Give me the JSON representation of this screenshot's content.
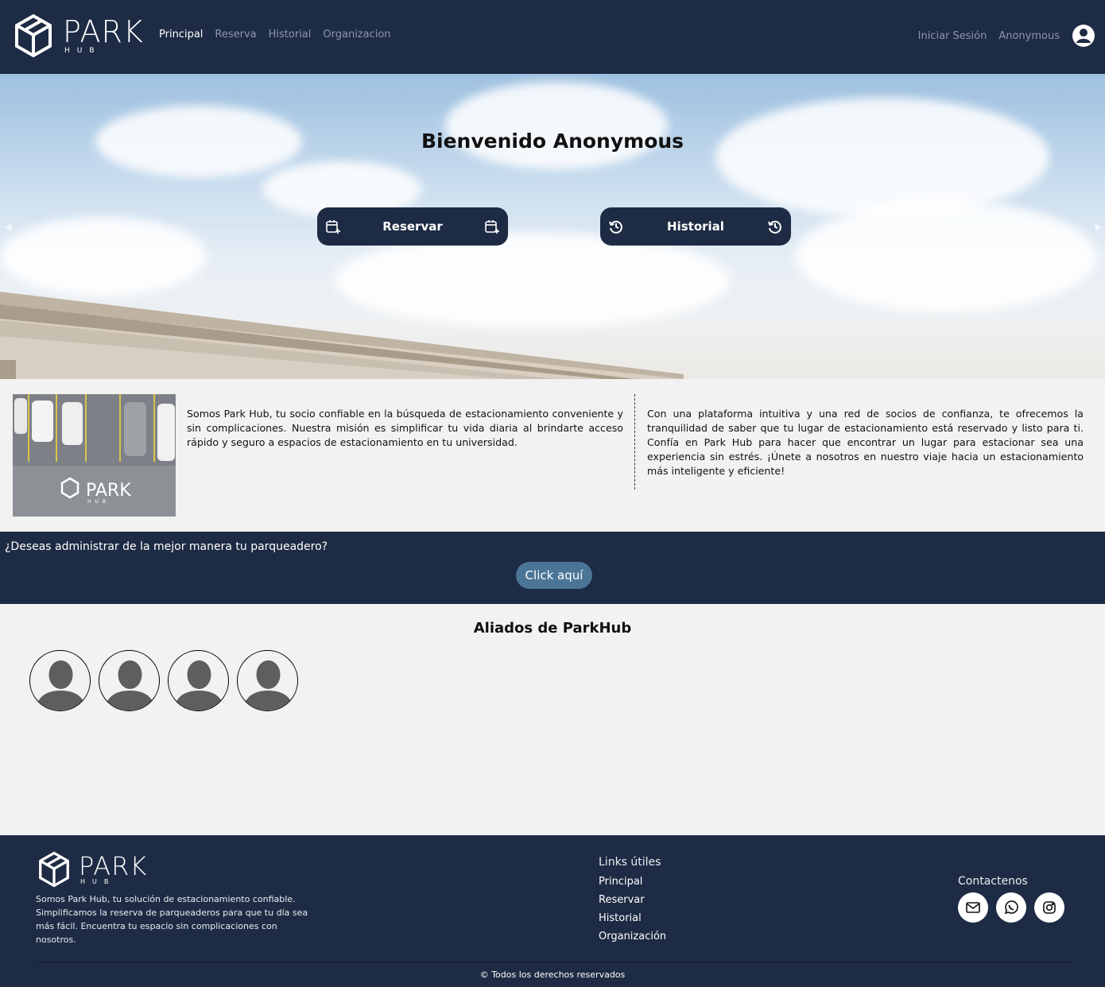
{
  "brand": {
    "name": "PARK",
    "sub": "HUB"
  },
  "nav": {
    "links": [
      {
        "label": "Principal",
        "active": true
      },
      {
        "label": "Reserva",
        "active": false
      },
      {
        "label": "Historial",
        "active": false
      },
      {
        "label": "Organizacion",
        "active": false
      }
    ],
    "login_label": "Iniciar Sesión",
    "username": "Anonymous",
    "user_icon": "user-circle-icon"
  },
  "hero": {
    "title": "Bienvenido Anonymous",
    "reservar_label": "Reservar",
    "reservar_icon": "calendar-plus-icon",
    "historial_label": "Historial",
    "historial_icon": "history-icon",
    "prev_arrow": "◀",
    "next_arrow": "▶"
  },
  "about": {
    "left_text": "Somos Park Hub, tu socio confiable en la búsqueda de estacionamiento conveniente y sin complicaciones. Nuestra misión es simplificar tu vida diaria al brindarte acceso rápido y seguro a espacios de estacionamiento en tu universidad.",
    "right_text": "Con una plataforma intuitiva y una red de socios de confianza, te ofrecemos la tranquilidad de saber que tu lugar de estacionamiento está reservado y listo para ti. Confía en Park Hub para hacer que encontrar un lugar para estacionar sea una experiencia sin estrés. ¡Únete a nosotros en nuestro viaje hacia un estacionamiento más inteligente y eficiente!"
  },
  "cta": {
    "question": "¿Deseas administrar de la mejor manera tu parqueadero?",
    "button_label": "Click aquí"
  },
  "allies": {
    "title": "Aliados de ParkHub",
    "items": [
      "ally-1",
      "ally-2",
      "ally-3",
      "ally-4"
    ]
  },
  "footer": {
    "description": "Somos Park Hub, tu solución de estacionamiento confiable. Simplificamos la reserva de parqueaderos para que tu día sea más fácil. Encuentra tu espacio sin complicaciones con nosotros.",
    "links_title": "Links útiles",
    "links": [
      "Principal",
      "Reservar",
      "Historial",
      "Organización"
    ],
    "contact_title": "Contactenos",
    "contact_icons": [
      "mail-icon",
      "whatsapp-icon",
      "instagram-icon"
    ],
    "copyright": "© Todos los derechos reservados"
  },
  "colors": {
    "navy": "#1e2b44",
    "page_bg": "#f2f2f2",
    "cta_button": "#4b7597",
    "nav_inactive": "#8a97ab"
  }
}
